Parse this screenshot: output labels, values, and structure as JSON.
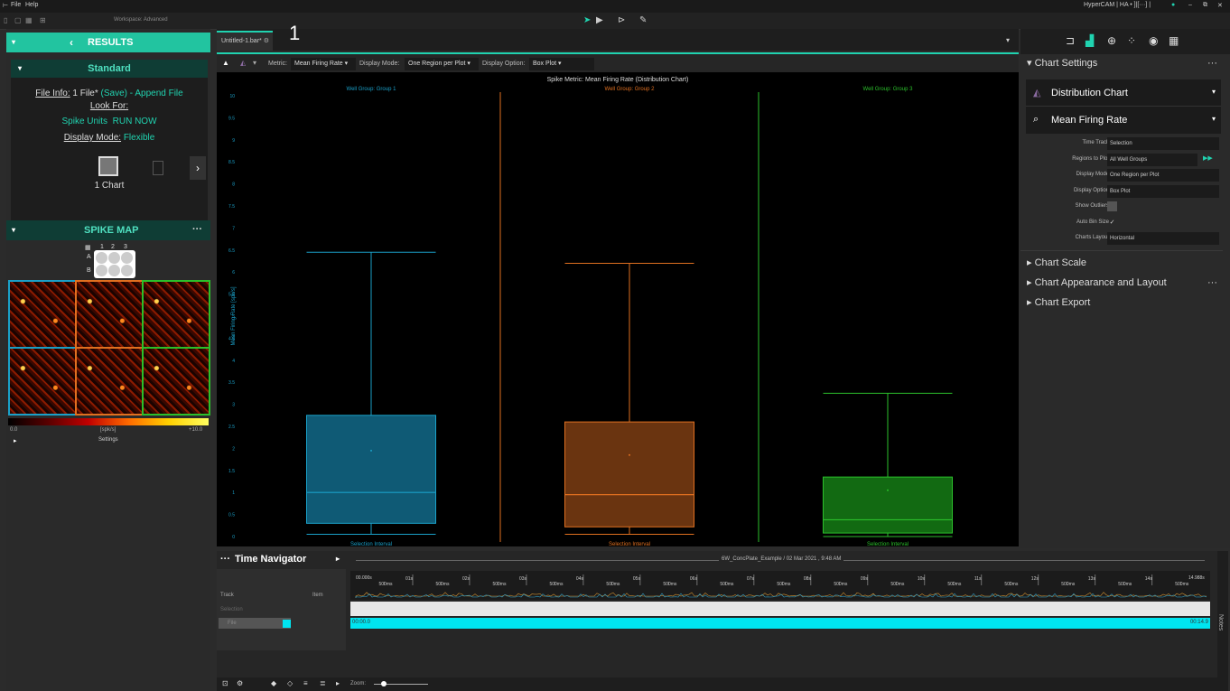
{
  "menu": {
    "file": "File",
    "help": "Help",
    "workspace": "Workspace: Advanced",
    "app_status": "HyperCAM | HA • ]|[···] |"
  },
  "left": {
    "results_label": "RESULTS",
    "standard_label": "Standard",
    "file_info_label": "File Info:",
    "file_info_value": "1 File*",
    "save": "(Save)",
    "append": "- Append File",
    "look_for_label": "Look For:",
    "spike_units": "Spike Units",
    "run_now": "RUN NOW",
    "display_mode_label": "Display Mode:",
    "display_mode_value": "Flexible",
    "chart_count": "1 Chart",
    "spike_map_label": "SPIKE MAP",
    "col1": "1",
    "col2": "2",
    "col3": "3",
    "rowA": "A",
    "rowB": "B",
    "scale_min": "0.0",
    "scale_unit": "[spk/s]",
    "scale_max": "+10.0",
    "settings": "Settings"
  },
  "center": {
    "tab_label": "Untitled-1.bar*",
    "tab_number": "1",
    "metric_label": "Metric:",
    "metric_value": "Mean Firing Rate",
    "display_mode_label": "Display Mode:",
    "display_mode_value": "One Region per Plot",
    "display_option_label": "Display Option:",
    "display_option_value": "Box Plot"
  },
  "chart_data": {
    "type": "box",
    "title": "Spike Metric: Mean Firing Rate (Distribution Chart)",
    "ylabel": "Mean Firing Rate [spk/s]",
    "ylim": [
      0,
      10
    ],
    "yticks": [
      "0",
      "0.5",
      "1",
      "1.5",
      "2",
      "2.5",
      "3",
      "3.5",
      "4",
      "4.5",
      "5",
      "5.5",
      "6",
      "6.5",
      "7",
      "7.5",
      "8",
      "8.5",
      "9",
      "9.5",
      "10"
    ],
    "series": [
      {
        "name": "Well Group: Group 1",
        "color": "#1aa0c8",
        "fill": "#0f5a75",
        "min": 0.05,
        "q1": 0.3,
        "median": 1.0,
        "q3": 2.75,
        "max": 6.45,
        "mean": 1.95,
        "footer": "Selection Interval"
      },
      {
        "name": "Well Group: Group 2",
        "color": "#e07020",
        "fill": "#6a3410",
        "min": 0.05,
        "q1": 0.22,
        "median": 0.95,
        "q3": 2.6,
        "max": 6.2,
        "mean": 1.85,
        "footer": "Selection Interval"
      },
      {
        "name": "Well Group: Group 3",
        "color": "#2bc02b",
        "fill": "#126a12",
        "min": 0.0,
        "q1": 0.08,
        "median": 0.38,
        "q3": 1.35,
        "max": 3.25,
        "mean": 1.05,
        "footer": "Selection Interval"
      }
    ]
  },
  "right": {
    "chart_settings": "Chart Settings",
    "chart_type": "Distribution Chart",
    "metric": "Mean Firing Rate",
    "settings": [
      {
        "label": "Time Track",
        "value": "Selection"
      },
      {
        "label": "Regions to Plot",
        "value": "All Well Groups"
      },
      {
        "label": "Display Mode",
        "value": "One Region per Plot"
      },
      {
        "label": "Display Option",
        "value": "Box Plot"
      },
      {
        "label": "Show Outliers",
        "value": ""
      },
      {
        "label": "Auto Bin Size",
        "value": "✓"
      },
      {
        "label": "Charts Layout",
        "value": "Horizontal"
      }
    ],
    "chart_scale": "Chart Scale",
    "appearance": "Chart Appearance and Layout",
    "export": "Chart Export"
  },
  "timenav": {
    "title": "Time Navigator",
    "file_caption": "6W_ConcPlate_Example / 02 Mar 2021 , 9:48 AM",
    "track": "Track",
    "item": "Item",
    "selection": "Selection",
    "file": "File",
    "start_time": "00:00.0",
    "end_time": "00:14.9",
    "time_start": "00.000s",
    "time_end": "14.988s",
    "seconds": [
      "01s",
      "02s",
      "03s",
      "04s",
      "05s",
      "06s",
      "07s",
      "08s",
      "09s",
      "10s",
      "11s",
      "12s",
      "13s",
      "14s"
    ],
    "half": "500ms",
    "zoom": "Zoom:",
    "notes": "Notes"
  }
}
